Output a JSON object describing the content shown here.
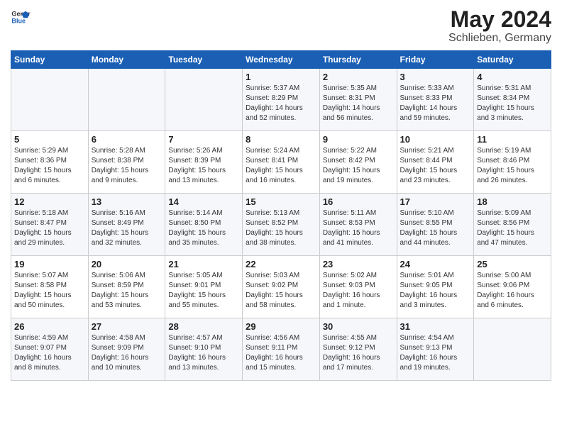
{
  "header": {
    "logo_general": "General",
    "logo_blue": "Blue",
    "month_title": "May 2024",
    "location": "Schlieben, Germany"
  },
  "weekdays": [
    "Sunday",
    "Monday",
    "Tuesday",
    "Wednesday",
    "Thursday",
    "Friday",
    "Saturday"
  ],
  "weeks": [
    [
      {
        "day": "",
        "sunrise": "",
        "sunset": "",
        "daylight": ""
      },
      {
        "day": "",
        "sunrise": "",
        "sunset": "",
        "daylight": ""
      },
      {
        "day": "",
        "sunrise": "",
        "sunset": "",
        "daylight": ""
      },
      {
        "day": "1",
        "sunrise": "Sunrise: 5:37 AM",
        "sunset": "Sunset: 8:29 PM",
        "daylight": "Daylight: 14 hours and 52 minutes."
      },
      {
        "day": "2",
        "sunrise": "Sunrise: 5:35 AM",
        "sunset": "Sunset: 8:31 PM",
        "daylight": "Daylight: 14 hours and 56 minutes."
      },
      {
        "day": "3",
        "sunrise": "Sunrise: 5:33 AM",
        "sunset": "Sunset: 8:33 PM",
        "daylight": "Daylight: 14 hours and 59 minutes."
      },
      {
        "day": "4",
        "sunrise": "Sunrise: 5:31 AM",
        "sunset": "Sunset: 8:34 PM",
        "daylight": "Daylight: 15 hours and 3 minutes."
      }
    ],
    [
      {
        "day": "5",
        "sunrise": "Sunrise: 5:29 AM",
        "sunset": "Sunset: 8:36 PM",
        "daylight": "Daylight: 15 hours and 6 minutes."
      },
      {
        "day": "6",
        "sunrise": "Sunrise: 5:28 AM",
        "sunset": "Sunset: 8:38 PM",
        "daylight": "Daylight: 15 hours and 9 minutes."
      },
      {
        "day": "7",
        "sunrise": "Sunrise: 5:26 AM",
        "sunset": "Sunset: 8:39 PM",
        "daylight": "Daylight: 15 hours and 13 minutes."
      },
      {
        "day": "8",
        "sunrise": "Sunrise: 5:24 AM",
        "sunset": "Sunset: 8:41 PM",
        "daylight": "Daylight: 15 hours and 16 minutes."
      },
      {
        "day": "9",
        "sunrise": "Sunrise: 5:22 AM",
        "sunset": "Sunset: 8:42 PM",
        "daylight": "Daylight: 15 hours and 19 minutes."
      },
      {
        "day": "10",
        "sunrise": "Sunrise: 5:21 AM",
        "sunset": "Sunset: 8:44 PM",
        "daylight": "Daylight: 15 hours and 23 minutes."
      },
      {
        "day": "11",
        "sunrise": "Sunrise: 5:19 AM",
        "sunset": "Sunset: 8:46 PM",
        "daylight": "Daylight: 15 hours and 26 minutes."
      }
    ],
    [
      {
        "day": "12",
        "sunrise": "Sunrise: 5:18 AM",
        "sunset": "Sunset: 8:47 PM",
        "daylight": "Daylight: 15 hours and 29 minutes."
      },
      {
        "day": "13",
        "sunrise": "Sunrise: 5:16 AM",
        "sunset": "Sunset: 8:49 PM",
        "daylight": "Daylight: 15 hours and 32 minutes."
      },
      {
        "day": "14",
        "sunrise": "Sunrise: 5:14 AM",
        "sunset": "Sunset: 8:50 PM",
        "daylight": "Daylight: 15 hours and 35 minutes."
      },
      {
        "day": "15",
        "sunrise": "Sunrise: 5:13 AM",
        "sunset": "Sunset: 8:52 PM",
        "daylight": "Daylight: 15 hours and 38 minutes."
      },
      {
        "day": "16",
        "sunrise": "Sunrise: 5:11 AM",
        "sunset": "Sunset: 8:53 PM",
        "daylight": "Daylight: 15 hours and 41 minutes."
      },
      {
        "day": "17",
        "sunrise": "Sunrise: 5:10 AM",
        "sunset": "Sunset: 8:55 PM",
        "daylight": "Daylight: 15 hours and 44 minutes."
      },
      {
        "day": "18",
        "sunrise": "Sunrise: 5:09 AM",
        "sunset": "Sunset: 8:56 PM",
        "daylight": "Daylight: 15 hours and 47 minutes."
      }
    ],
    [
      {
        "day": "19",
        "sunrise": "Sunrise: 5:07 AM",
        "sunset": "Sunset: 8:58 PM",
        "daylight": "Daylight: 15 hours and 50 minutes."
      },
      {
        "day": "20",
        "sunrise": "Sunrise: 5:06 AM",
        "sunset": "Sunset: 8:59 PM",
        "daylight": "Daylight: 15 hours and 53 minutes."
      },
      {
        "day": "21",
        "sunrise": "Sunrise: 5:05 AM",
        "sunset": "Sunset: 9:01 PM",
        "daylight": "Daylight: 15 hours and 55 minutes."
      },
      {
        "day": "22",
        "sunrise": "Sunrise: 5:03 AM",
        "sunset": "Sunset: 9:02 PM",
        "daylight": "Daylight: 15 hours and 58 minutes."
      },
      {
        "day": "23",
        "sunrise": "Sunrise: 5:02 AM",
        "sunset": "Sunset: 9:03 PM",
        "daylight": "Daylight: 16 hours and 1 minute."
      },
      {
        "day": "24",
        "sunrise": "Sunrise: 5:01 AM",
        "sunset": "Sunset: 9:05 PM",
        "daylight": "Daylight: 16 hours and 3 minutes."
      },
      {
        "day": "25",
        "sunrise": "Sunrise: 5:00 AM",
        "sunset": "Sunset: 9:06 PM",
        "daylight": "Daylight: 16 hours and 6 minutes."
      }
    ],
    [
      {
        "day": "26",
        "sunrise": "Sunrise: 4:59 AM",
        "sunset": "Sunset: 9:07 PM",
        "daylight": "Daylight: 16 hours and 8 minutes."
      },
      {
        "day": "27",
        "sunrise": "Sunrise: 4:58 AM",
        "sunset": "Sunset: 9:09 PM",
        "daylight": "Daylight: 16 hours and 10 minutes."
      },
      {
        "day": "28",
        "sunrise": "Sunrise: 4:57 AM",
        "sunset": "Sunset: 9:10 PM",
        "daylight": "Daylight: 16 hours and 13 minutes."
      },
      {
        "day": "29",
        "sunrise": "Sunrise: 4:56 AM",
        "sunset": "Sunset: 9:11 PM",
        "daylight": "Daylight: 16 hours and 15 minutes."
      },
      {
        "day": "30",
        "sunrise": "Sunrise: 4:55 AM",
        "sunset": "Sunset: 9:12 PM",
        "daylight": "Daylight: 16 hours and 17 minutes."
      },
      {
        "day": "31",
        "sunrise": "Sunrise: 4:54 AM",
        "sunset": "Sunset: 9:13 PM",
        "daylight": "Daylight: 16 hours and 19 minutes."
      },
      {
        "day": "",
        "sunrise": "",
        "sunset": "",
        "daylight": ""
      }
    ]
  ]
}
